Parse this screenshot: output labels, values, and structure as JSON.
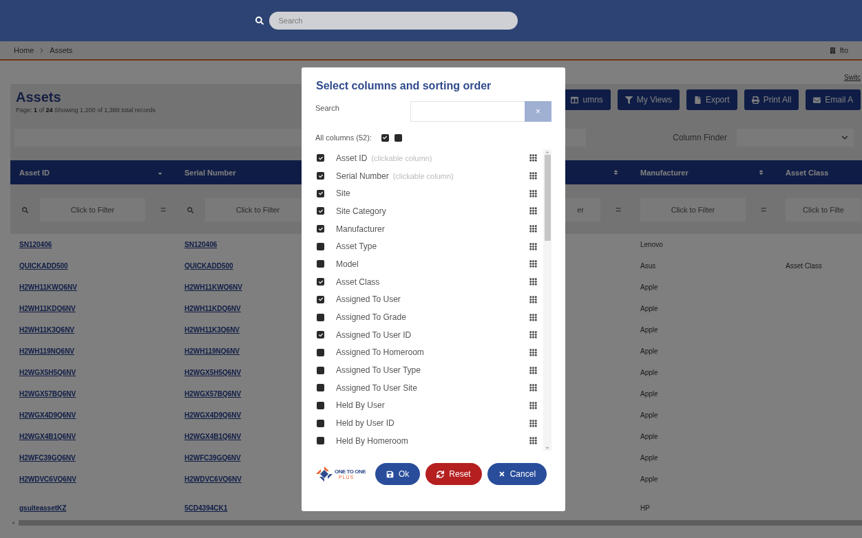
{
  "top_bar": {
    "search": {
      "placeholder": "Search"
    }
  },
  "breadcrumb": {
    "items": [
      "Home",
      "Assets"
    ],
    "user": "fto"
  },
  "switch_link": "Switc",
  "page": {
    "title": "Assets",
    "summary": "Page:  **1** of **24** Showing 1,200 of 1,388 total records"
  },
  "toolbar": [
    {
      "kind": "columns",
      "label": "umns"
    },
    {
      "kind": "views",
      "label": "My Views"
    },
    {
      "kind": "export",
      "label": "Export"
    },
    {
      "kind": "print",
      "label": "Print All"
    },
    {
      "kind": "email",
      "label": "Email A"
    }
  ],
  "column_finder": {
    "label": "Column Finder"
  },
  "table": {
    "columns": [
      {
        "label": "Asset ID",
        "sorted": true,
        "filter": {
          "search_icon": true,
          "placeholder": "Click to Filter",
          "operator": "="
        }
      },
      {
        "label": "Serial Number",
        "filter": {
          "search_icon": true,
          "placeholder": "Click to Filter"
        }
      },
      {
        "sorted": false,
        "filter": {
          "search_icon": false,
          "placeholder": "er",
          "operator": "="
        }
      },
      {
        "label": "Manufacturer",
        "sorted": false,
        "filter": {
          "search_icon": false,
          "placeholder": "Click to Filter",
          "operator": "="
        }
      },
      {
        "label": "Asset Class",
        "filter": {
          "search_icon": false,
          "placeholder": "Click to Filte"
        }
      }
    ],
    "rows": [
      {
        "asset_id": "SN120406",
        "serial_number": "SN120406",
        "manufacturer": "Lenovo"
      },
      {
        "asset_id": "QUICKADD500",
        "serial_number": "QUICKADD500",
        "manufacturer": "Asus",
        "asset_class": "Asset Class"
      },
      {
        "asset_id": "H2WH11KWQ6NV",
        "serial_number": "H2WH11KWQ6NV",
        "manufacturer": "Apple"
      },
      {
        "asset_id": "H2WH11KDQ6NV",
        "serial_number": "H2WH11KDQ6NV",
        "manufacturer": "Apple"
      },
      {
        "asset_id": "H2WH11K3Q6NV",
        "serial_number": "H2WH11K3Q6NV",
        "manufacturer": "Apple"
      },
      {
        "asset_id": "H2WH119NQ6NV",
        "serial_number": "H2WH119NQ6NV",
        "manufacturer": "Apple"
      },
      {
        "asset_id": "H2WGX5H5Q6NV",
        "serial_number": "H2WGX5H5Q6NV",
        "manufacturer": "Apple"
      },
      {
        "asset_id": "H2WGX57BQ6NV",
        "serial_number": "H2WGX57BQ6NV",
        "manufacturer": "Apple"
      },
      {
        "asset_id": "H2WGX4D9Q6NV",
        "serial_number": "H2WGX4D9Q6NV",
        "manufacturer": "Apple"
      },
      {
        "asset_id": "H2WGX4B1Q6NV",
        "serial_number": "H2WGX4B1Q6NV",
        "manufacturer": "Apple"
      },
      {
        "asset_id": "H2WFC39GQ6NV",
        "serial_number": "H2WFC39GQ6NV",
        "manufacturer": "Apple"
      },
      {
        "asset_id": "H2WDVC6VQ6NV",
        "serial_number": "H2WDVC6VQ6NV",
        "manufacturer": "Apple"
      },
      {
        "asset_id": "gsuiteassetKZ",
        "serial_number": "5CD4394CK1",
        "manufacturer": "HP"
      }
    ]
  },
  "modal": {
    "title": "Select columns and sorting order",
    "search": {
      "label": "Search",
      "clear": "×"
    },
    "all_columns": "All columns (52):",
    "columns": [
      {
        "label": "Asset ID",
        "note": "(clickable column)",
        "checked": true
      },
      {
        "label": "Serial Number",
        "note": "(clickable column)",
        "checked": true
      },
      {
        "label": "Site",
        "checked": true
      },
      {
        "label": "Site Category",
        "checked": true
      },
      {
        "label": "Manufacturer",
        "checked": true
      },
      {
        "label": "Asset Type",
        "checked": false
      },
      {
        "label": "Model",
        "checked": false
      },
      {
        "label": "Asset Class",
        "checked": true
      },
      {
        "label": "Assigned To User",
        "checked": true
      },
      {
        "label": "Assigned To Grade",
        "checked": false
      },
      {
        "label": "Assigned To User ID",
        "checked": true
      },
      {
        "label": "Assigned To Homeroom",
        "checked": false
      },
      {
        "label": "Assigned To User Type",
        "checked": false
      },
      {
        "label": "Assigned To User Site",
        "checked": false
      },
      {
        "label": "Held By User",
        "checked": false
      },
      {
        "label": "Held by User ID",
        "checked": false
      },
      {
        "label": "Held By Homeroom",
        "checked": false
      }
    ],
    "logo": {
      "name": "ONE TO ONE",
      "tagline": "PLUS"
    },
    "buttons": [
      {
        "kind": "ok",
        "label": "Ok"
      },
      {
        "kind": "reset",
        "label": "Reset"
      },
      {
        "kind": "cancel",
        "label": "Cancel"
      }
    ]
  }
}
